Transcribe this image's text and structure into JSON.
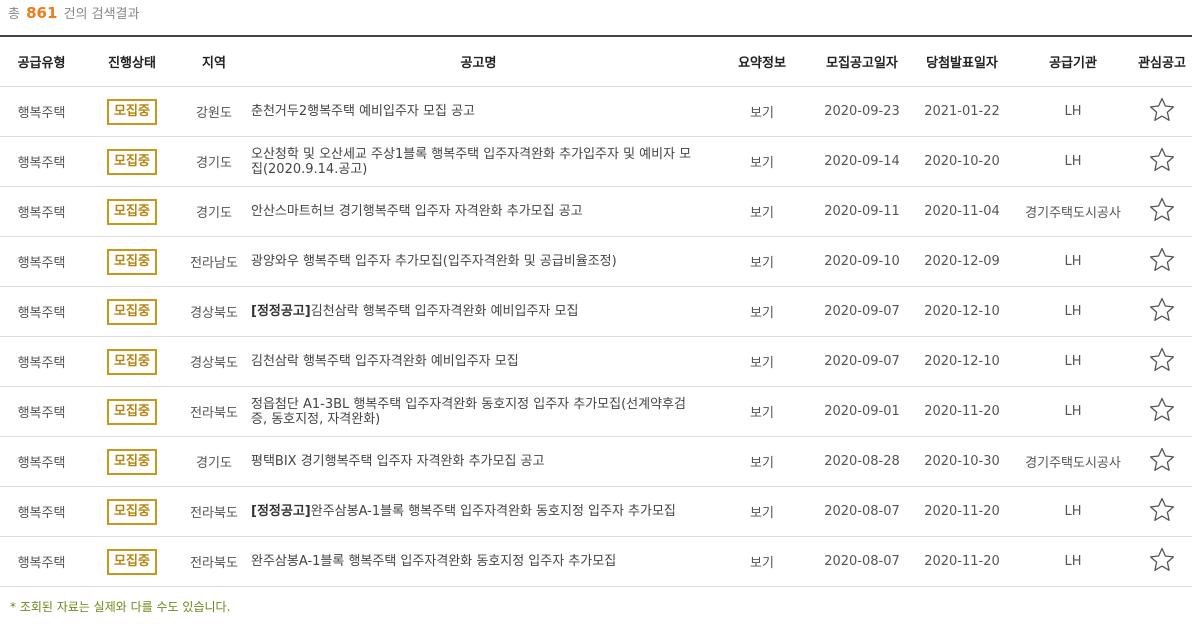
{
  "summary": {
    "prefix": "총",
    "count": "861",
    "suffix": "건의 검색결과"
  },
  "columns": [
    "공급유형",
    "진행상태",
    "지역",
    "공고명",
    "요약정보",
    "모집공고일자",
    "당첨발표일자",
    "공급기관",
    "관심공고"
  ],
  "colors": {
    "accent": "#ee7b1d",
    "badge": "#c8981c",
    "note": "#6a8a1c"
  },
  "icons": {
    "favorite": "star-outline-icon"
  },
  "rows": [
    {
      "type": "행복주택",
      "status": "모집중",
      "region": "강원도",
      "tag": "",
      "title": "춘천거두2행복주택 예비입주자 모집 공고",
      "summary": "보기",
      "notice_date": "2020-09-23",
      "announce_date": "2021-01-22",
      "agency": "LH"
    },
    {
      "type": "행복주택",
      "status": "모집중",
      "region": "경기도",
      "tag": "",
      "title": "오산청학 및 오산세교 주상1블록 행복주택 입주자격완화 추가입주자 및 예비자 모집(2020.9.14.공고)",
      "summary": "보기",
      "notice_date": "2020-09-14",
      "announce_date": "2020-10-20",
      "agency": "LH"
    },
    {
      "type": "행복주택",
      "status": "모집중",
      "region": "경기도",
      "tag": "",
      "title": "안산스마트허브 경기행복주택 입주자 자격완화 추가모집 공고",
      "summary": "보기",
      "notice_date": "2020-09-11",
      "announce_date": "2020-11-04",
      "agency": "경기주택도시공사"
    },
    {
      "type": "행복주택",
      "status": "모집중",
      "region": "전라남도",
      "tag": "",
      "title": "광양와우 행복주택 입주자 추가모집(입주자격완화 및 공급비율조정)",
      "summary": "보기",
      "notice_date": "2020-09-10",
      "announce_date": "2020-12-09",
      "agency": "LH"
    },
    {
      "type": "행복주택",
      "status": "모집중",
      "region": "경상북도",
      "tag": "[정정공고]",
      "title": "김천삼락 행복주택 입주자격완화 예비입주자 모집",
      "summary": "보기",
      "notice_date": "2020-09-07",
      "announce_date": "2020-12-10",
      "agency": "LH"
    },
    {
      "type": "행복주택",
      "status": "모집중",
      "region": "경상북도",
      "tag": "",
      "title": "김천삼락 행복주택 입주자격완화 예비입주자 모집",
      "summary": "보기",
      "notice_date": "2020-09-07",
      "announce_date": "2020-12-10",
      "agency": "LH"
    },
    {
      "type": "행복주택",
      "status": "모집중",
      "region": "전라북도",
      "tag": "",
      "title": "정읍첨단 A1-3BL 행복주택 입주자격완화 동호지정 입주자 추가모집(선계약후검증, 동호지정, 자격완화)",
      "summary": "보기",
      "notice_date": "2020-09-01",
      "announce_date": "2020-11-20",
      "agency": "LH"
    },
    {
      "type": "행복주택",
      "status": "모집중",
      "region": "경기도",
      "tag": "",
      "title": "평택BIX 경기행복주택 입주자 자격완화 추가모집 공고",
      "summary": "보기",
      "notice_date": "2020-08-28",
      "announce_date": "2020-10-30",
      "agency": "경기주택도시공사"
    },
    {
      "type": "행복주택",
      "status": "모집중",
      "region": "전라북도",
      "tag": "[정정공고]",
      "title": "완주삼봉A-1블록 행복주택 입주자격완화 동호지정 입주자 추가모집",
      "summary": "보기",
      "notice_date": "2020-08-07",
      "announce_date": "2020-11-20",
      "agency": "LH"
    },
    {
      "type": "행복주택",
      "status": "모집중",
      "region": "전라북도",
      "tag": "",
      "title": "완주삼봉A-1블록 행복주택 입주자격완화 동호지정 입주자 추가모집",
      "summary": "보기",
      "notice_date": "2020-08-07",
      "announce_date": "2020-11-20",
      "agency": "LH"
    }
  ],
  "footnote": "* 조회된 자료는 실제와 다를 수도 있습니다."
}
